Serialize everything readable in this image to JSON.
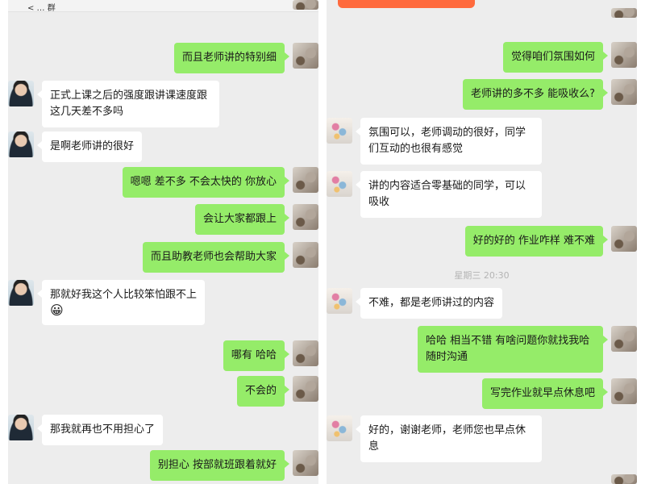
{
  "left": {
    "header_text": "< … 群",
    "messages": [
      {
        "from": "self",
        "text": "而且老师讲的特别细"
      },
      {
        "from": "other",
        "text": "正式上课之后的强度跟讲课速度跟这几天差不多吗"
      },
      {
        "from": "other",
        "text": "是啊老师讲的很好"
      },
      {
        "from": "self",
        "text": "嗯嗯 差不多 不会太快的 你放心"
      },
      {
        "from": "self",
        "text": "会让大家都跟上"
      },
      {
        "from": "self",
        "text": "而且助教老师也会帮助大家"
      },
      {
        "from": "other",
        "text": "那就好我这个人比较笨怕跟不上",
        "emoji": "😀"
      },
      {
        "from": "self",
        "text": "哪有 哈哈"
      },
      {
        "from": "self",
        "text": "不会的"
      },
      {
        "from": "other",
        "text": "那我就再也不用担心了"
      },
      {
        "from": "self",
        "text": "别担心 按部就班跟着就好"
      }
    ]
  },
  "right": {
    "messages": [
      {
        "from": "self",
        "text": "觉得咱们氛围如何"
      },
      {
        "from": "self",
        "text": "老师讲的多不多 能吸收么?"
      },
      {
        "from": "other",
        "text": "氛围可以，老师调动的很好，同学们互动的也很有感觉"
      },
      {
        "from": "other",
        "text": "讲的内容适合零基础的同学，可以吸收"
      },
      {
        "from": "self",
        "text": "好的好的 作业咋样 难不难"
      },
      {
        "from": "other",
        "text": "不难，都是老师讲过的内容"
      },
      {
        "from": "self",
        "text": "哈哈 相当不错  有啥问题你就找我哈随时沟通"
      },
      {
        "from": "self",
        "text": "写完作业就早点休息吧"
      },
      {
        "from": "other",
        "text": "好的，谢谢老师，老师您也早点休息"
      }
    ],
    "timestamp": "星期三 20:30"
  },
  "colors": {
    "outgoing_bubble": "#95ec69",
    "incoming_bubble": "#ffffff",
    "chat_background": "#ededed",
    "timestamp_text": "#b4b4b4"
  },
  "icons": {
    "self_avatar": "avatar-image",
    "left_contact_avatar": "boy-photo-avatar",
    "right_contact_avatar": "flower-avatar"
  }
}
